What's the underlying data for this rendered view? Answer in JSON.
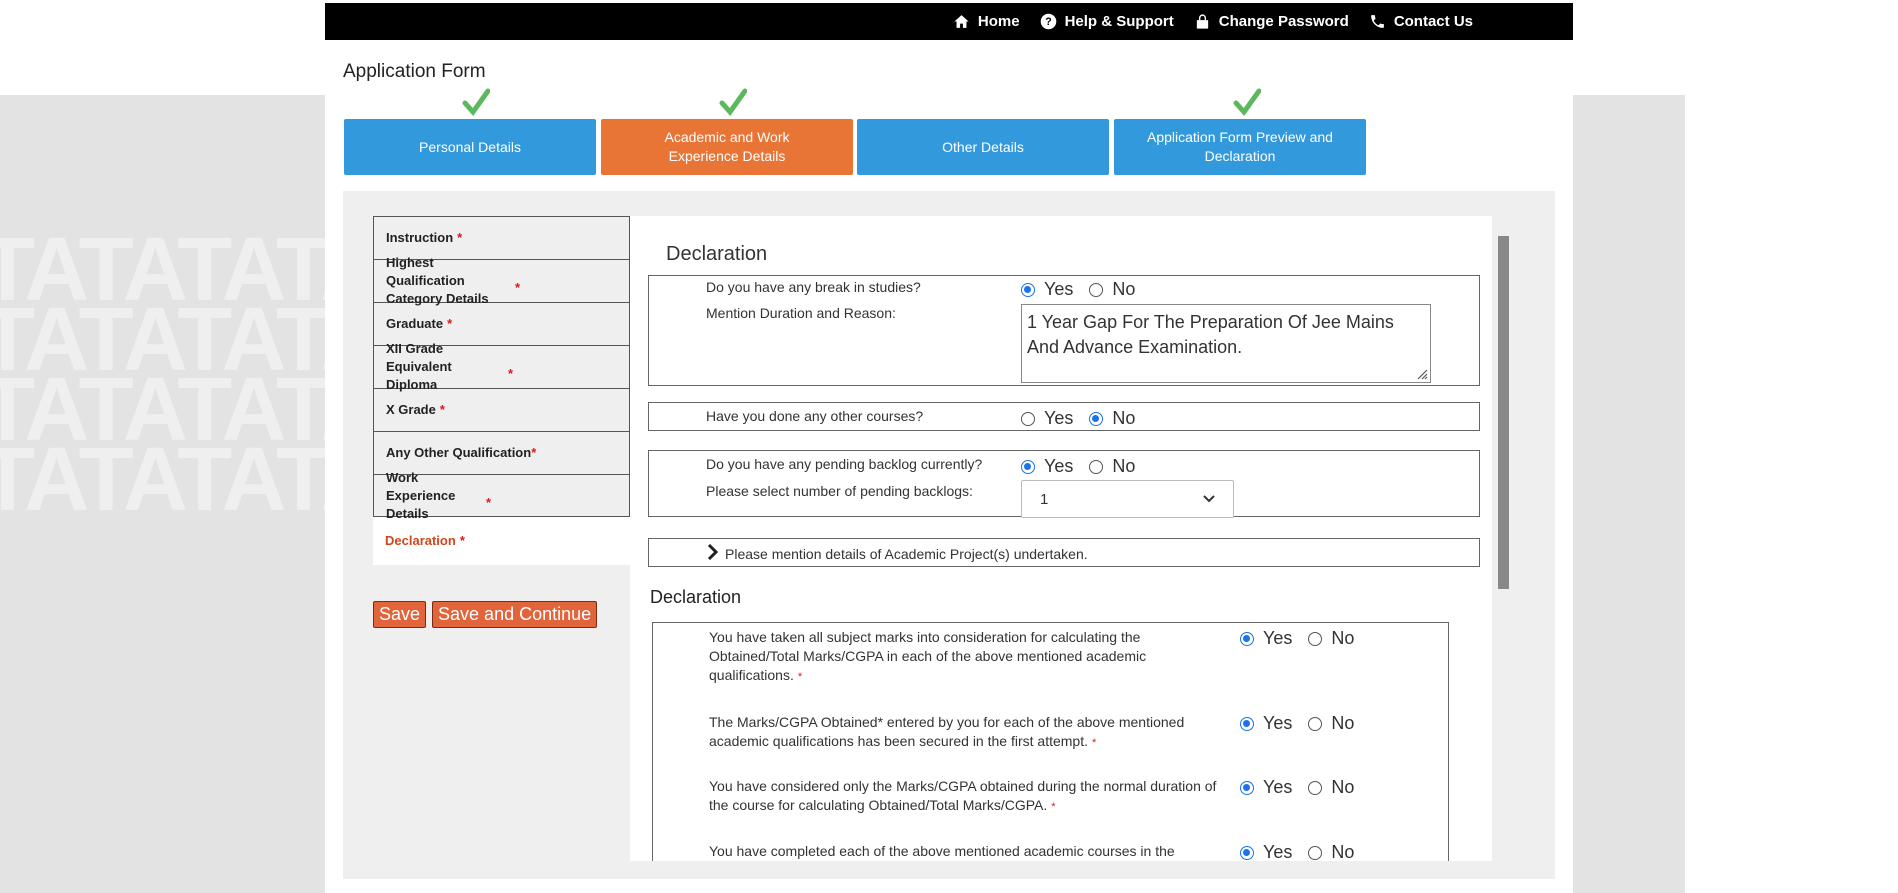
{
  "topnav": {
    "home": "Home",
    "help": "Help & Support",
    "change_password": "Change Password",
    "contact": "Contact Us"
  },
  "watermark_text": "TATATATATATATATATATATATATATA",
  "page_title": "Application Form",
  "steps": {
    "personal": "Personal Details",
    "academic": "Academic and Work Experience Details",
    "other": "Other Details",
    "preview": "Application Form Preview and Declaration"
  },
  "sidenav": {
    "instruction": "Instruction",
    "highest": "Highest Qualification Category Details",
    "graduate": "Graduate",
    "xii": "XII Grade Equivalent Diploma",
    "x": "X Grade",
    "other_qual": "Any Other Qualification",
    "work": "Work Experience Details",
    "declaration": "Declaration",
    "required_mark": "*"
  },
  "buttons": {
    "save": "Save",
    "save_continue": "Save and Continue"
  },
  "form": {
    "section_title": "Declaration",
    "yes": "Yes",
    "no": "No",
    "break_q": "Do you have any break in studies?",
    "break_answer": "Yes",
    "duration_label": "Mention Duration and Reason:",
    "duration_value": "1 Year Gap For The Preparation Of Jee Mains And Advance Examination.",
    "courses_q": "Have you done any other courses?",
    "courses_answer": "No",
    "backlog_q": "Do you have any pending backlog currently?",
    "backlog_answer": "Yes",
    "backlog_count_label": "Please select number of pending backlogs:",
    "backlog_count_value": "1",
    "projects_label": "Please mention details of Academic Project(s) undertaken."
  },
  "declaration": {
    "title": "Declaration",
    "items": [
      {
        "text": "You have taken all subject marks into consideration for calculating the Obtained/Total Marks/CGPA in each of the above mentioned academic qualifications.",
        "answer": "Yes"
      },
      {
        "text": "The Marks/CGPA Obtained* entered by you for each of the above mentioned academic qualifications has been secured in the first attempt.",
        "answer": "Yes"
      },
      {
        "text": "You have considered only the Marks/CGPA obtained during the normal duration of the course for calculating Obtained/Total Marks/CGPA.",
        "answer": "Yes"
      },
      {
        "text": "You have completed each of the above mentioned academic courses in the stipulated time as specified by your University/Institute. (example: TCS)",
        "answer": "Yes"
      }
    ],
    "required_mark": "*"
  },
  "colors": {
    "step_blue": "#3399dd",
    "step_orange": "#e87436",
    "check_green": "#5cb85c",
    "button_orange": "#e1643b",
    "radio_blue": "#1a73e8"
  },
  "icons": [
    "home-icon",
    "help-icon",
    "lock-icon",
    "phone-icon",
    "checkmark-icon",
    "chevron-right-icon",
    "chevron-down-icon",
    "resize-handle-icon"
  ]
}
